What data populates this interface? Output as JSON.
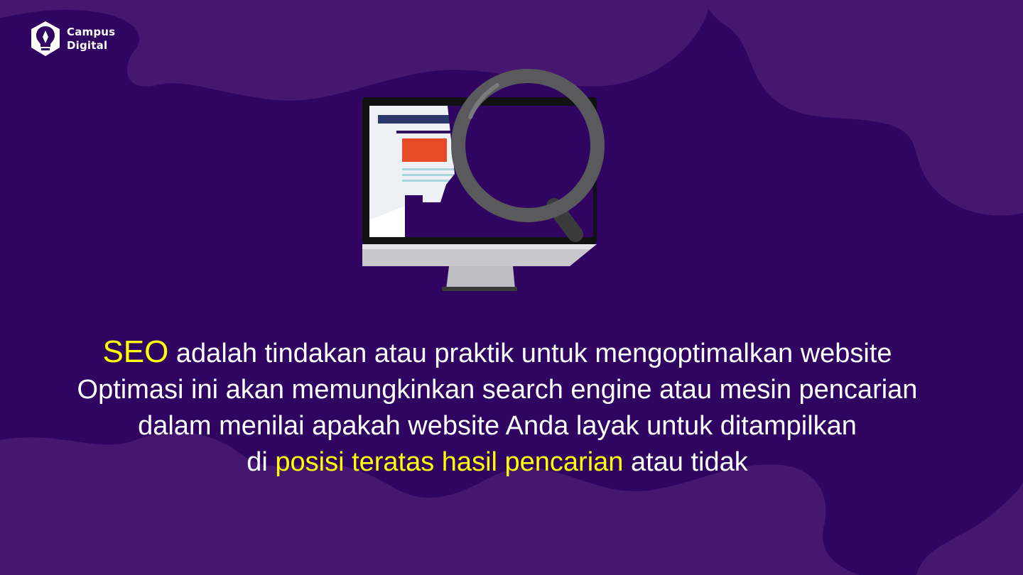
{
  "brand": {
    "line1": "Campus",
    "line2": "Digital"
  },
  "caption": {
    "line1_highlight": "SEO",
    "line1_rest": " adalah tindakan atau praktik untuk mengoptimalkan website",
    "line2": "Optimasi ini akan memungkinkan search engine atau mesin pencarian",
    "line3": "dalam menilai apakah website Anda layak untuk ditampilkan",
    "line4_prefix": "di ",
    "line4_highlight": "posisi teratas hasil pencarian",
    "line4_suffix": " atau tidak"
  },
  "colors": {
    "background": "#300562",
    "blob": "#45176f",
    "highlight": "#ffff00",
    "text": "#ffffff"
  },
  "icons": [
    "campus-digital-logo-icon",
    "monitor-icon",
    "magnifying-glass-icon"
  ]
}
